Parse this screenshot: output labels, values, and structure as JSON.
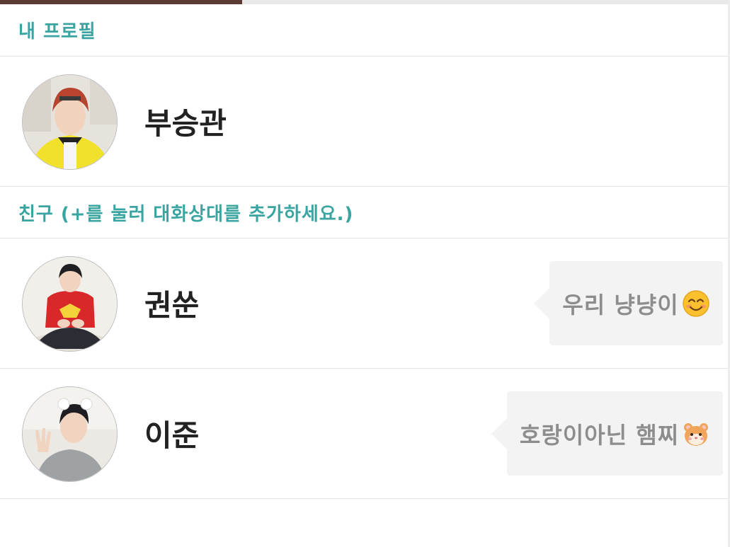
{
  "progress": {
    "fraction": 0.332,
    "color": "#5a3a32"
  },
  "sections": {
    "my_profile": "내 프로필",
    "friends": "친구 (+를 눌러 대화상대를 추가하세요.)"
  },
  "my_profile": {
    "name": "부승관"
  },
  "friends": [
    {
      "name": "권쑨",
      "status": "우리 냥냥이",
      "emoji": "smiling-face-icon"
    },
    {
      "name": "이준",
      "status": "호랑이아닌 햄찌",
      "emoji": "hamster-face-icon"
    }
  ],
  "colors": {
    "section_header": "#3aa5a0",
    "name_text": "#222222",
    "bubble_bg": "#f3f3f3",
    "bubble_text": "#8d8d8d"
  }
}
